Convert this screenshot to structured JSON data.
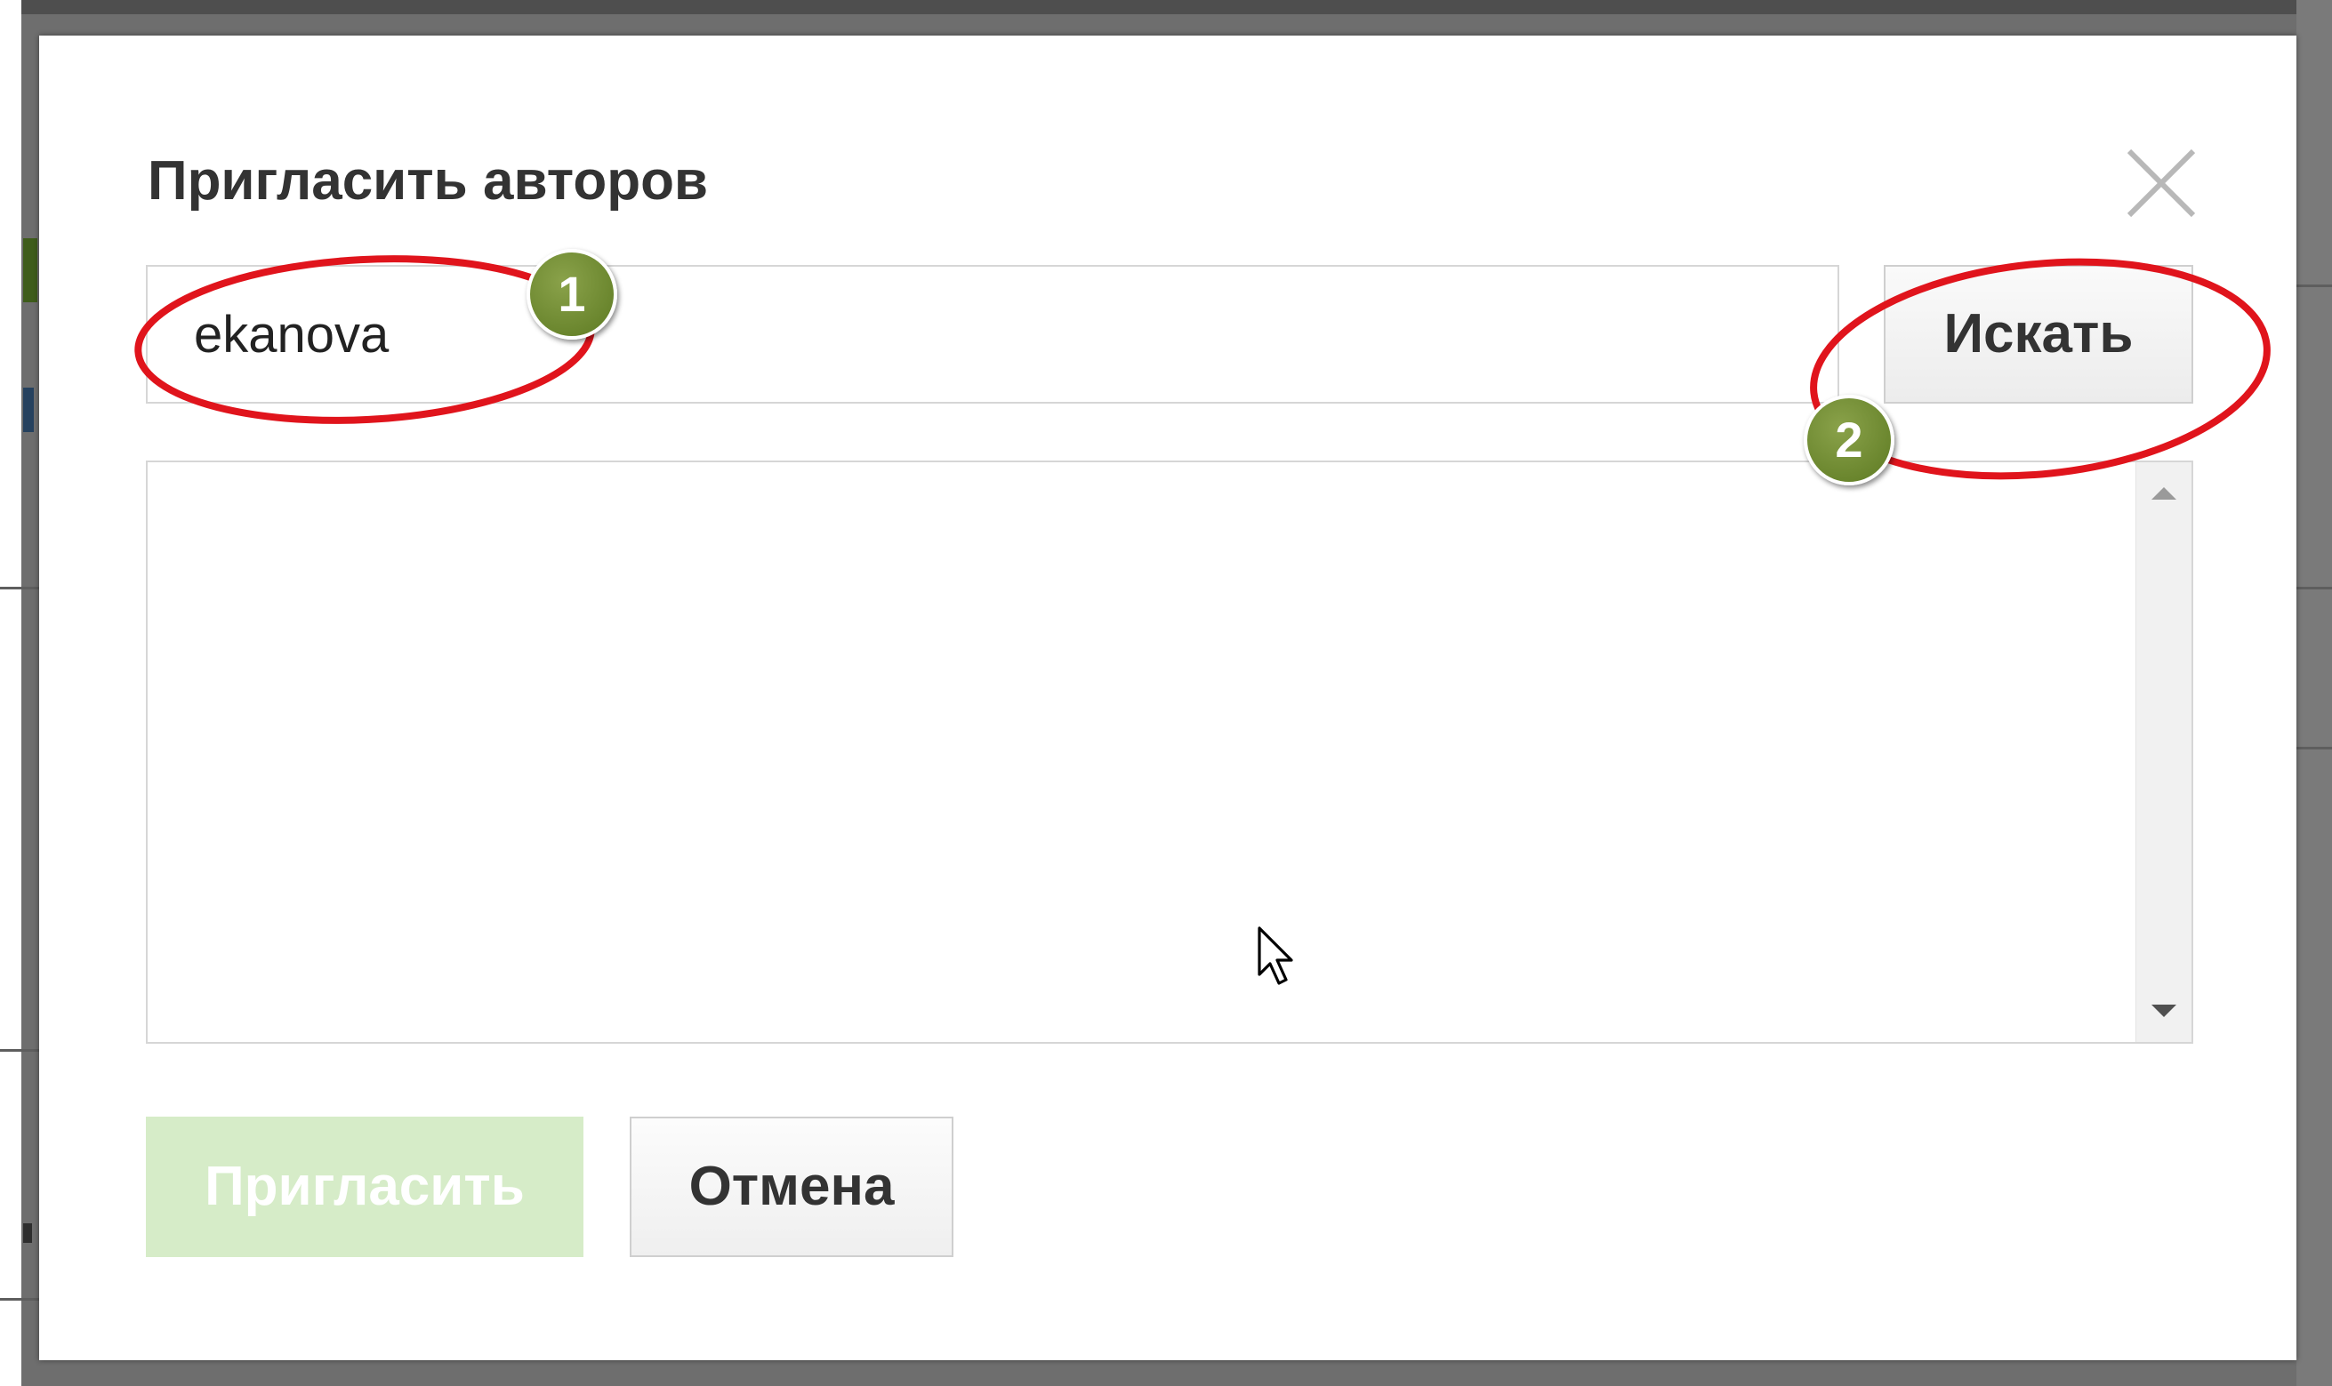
{
  "dialog": {
    "title": "Пригласить авторов",
    "search_value": "ekanova",
    "search_button_label": "Искать",
    "invite_button_label": "Пригласить",
    "cancel_button_label": "Отмена"
  },
  "annotations": {
    "step_1_label": "1",
    "step_2_label": "2",
    "ellipse_color": "#e0141c",
    "badge_color": "#6f8a2e"
  },
  "colors": {
    "invite_disabled_bg": "#d6ecc8",
    "backdrop": "#6e6e6e"
  }
}
